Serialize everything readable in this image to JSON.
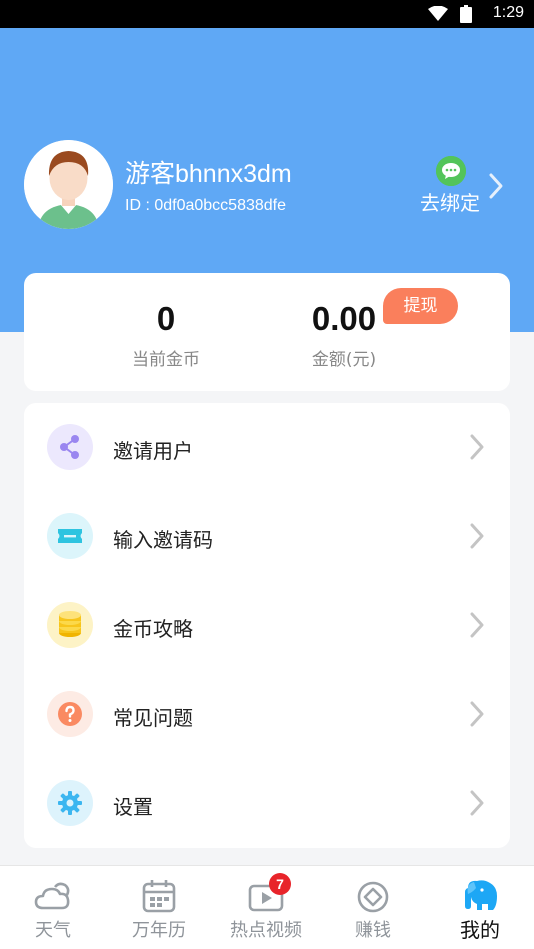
{
  "status_bar": {
    "time": "1:29"
  },
  "profile": {
    "username": "游客bhnnx3dm",
    "user_id": "ID : 0df0a0bcc5838dfe",
    "bind_label": "去绑定"
  },
  "wallet": {
    "coins_value": "0",
    "coins_label": "当前金币",
    "amount_value": "0.00",
    "amount_label": "金额(元)",
    "withdraw_label": "提现"
  },
  "menu": {
    "items": [
      {
        "label": "邀请用户",
        "icon": "share-icon",
        "color": "#9a86f0"
      },
      {
        "label": "输入邀请码",
        "icon": "ticket-icon",
        "color": "#2ec4e0"
      },
      {
        "label": "金币攻略",
        "icon": "coins-icon",
        "color": "#f7c51c"
      },
      {
        "label": "常见问题",
        "icon": "question-icon",
        "color": "#fa8a62"
      },
      {
        "label": "设置",
        "icon": "settings-icon",
        "color": "#3bb6f0"
      }
    ]
  },
  "bottom_nav": {
    "tabs": [
      {
        "label": "天气",
        "icon": "weather-icon"
      },
      {
        "label": "万年历",
        "icon": "calendar-icon"
      },
      {
        "label": "热点视频",
        "icon": "video-icon",
        "badge": "7"
      },
      {
        "label": "赚钱",
        "icon": "earn-icon"
      },
      {
        "label": "我的",
        "icon": "elephant-icon",
        "active": true
      }
    ]
  },
  "colors": {
    "header_blue": "#5fa8f5",
    "accent_orange": "#fa7f5c",
    "wechat_green": "#53c45a",
    "badge_red": "#e8242a",
    "active_tab": "#1da7f5"
  }
}
